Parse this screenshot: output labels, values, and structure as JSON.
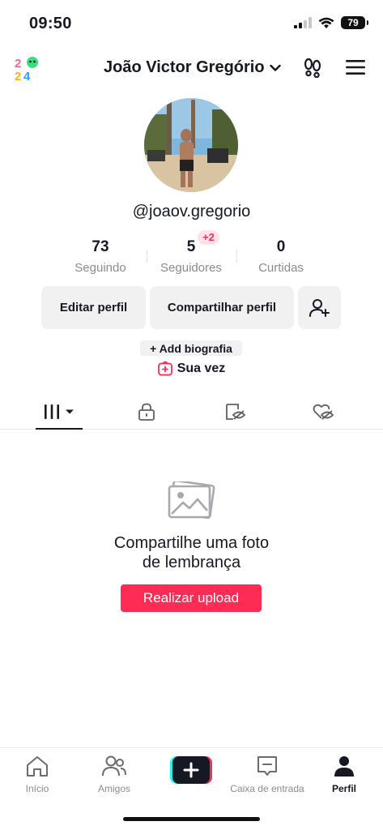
{
  "status_bar": {
    "time": "09:50",
    "battery": "79"
  },
  "header": {
    "title": "João Victor Gregório"
  },
  "profile": {
    "handle": "@joaov.gregorio"
  },
  "stats": [
    {
      "value": "73",
      "label": "Seguindo"
    },
    {
      "value": "5",
      "label": "Seguidores",
      "badge": "+2"
    },
    {
      "value": "0",
      "label": "Curtidas"
    }
  ],
  "actions": {
    "edit": "Editar perfil",
    "share": "Compartilhar perfil"
  },
  "bio": {
    "add_label": "+ Add biografia"
  },
  "story": {
    "label": "Sua vez"
  },
  "empty_state": {
    "line1": "Compartilhe uma foto",
    "line2": "de lembrança",
    "button": "Realizar upload"
  },
  "nav": {
    "home": "Início",
    "friends": "Amigos",
    "inbox": "Caixa de entrada",
    "profile": "Perfil"
  },
  "colors": {
    "accent": "#fe2c55",
    "text": "#161823",
    "muted": "#8a8b91"
  }
}
